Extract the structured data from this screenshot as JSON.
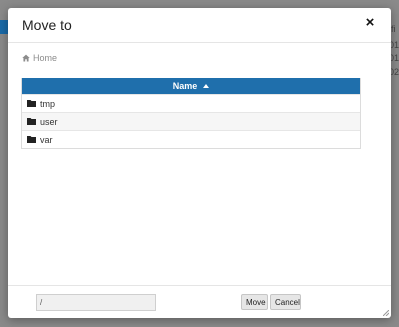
{
  "background": {
    "fragments": [
      "ifi",
      "01:",
      "01:",
      "02:"
    ]
  },
  "modal": {
    "title": "Move to",
    "close_label": "×",
    "breadcrumb": {
      "home_label": "Home",
      "home_icon": "home-icon"
    },
    "table": {
      "header": {
        "name_label": "Name",
        "sort": "ascending"
      },
      "rows": [
        {
          "name": "tmp",
          "icon": "folder-icon"
        },
        {
          "name": "user",
          "icon": "folder-icon"
        },
        {
          "name": "var",
          "icon": "folder-icon"
        }
      ]
    },
    "footer": {
      "path_value": "/",
      "move_label": "Move",
      "cancel_label": "Cancel"
    }
  },
  "colors": {
    "header_bg": "#1f6fac",
    "overlay": "#8a8a8a"
  }
}
